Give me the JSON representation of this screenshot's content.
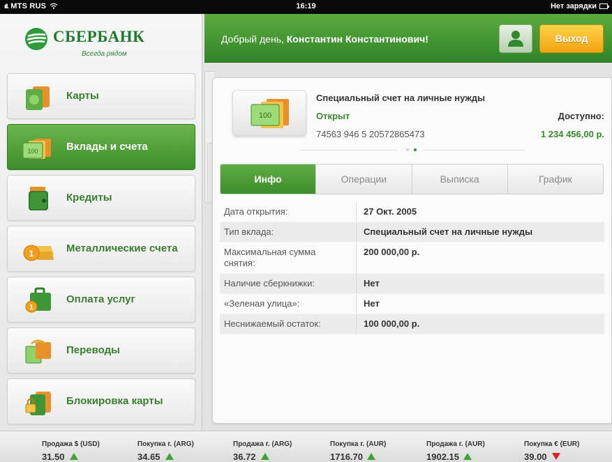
{
  "statusbar": {
    "carrier": "MTS RUS",
    "time": "16:19",
    "battery": "Нет зарядки"
  },
  "brand": {
    "name": "СБЕРБАНК",
    "tagline": "Всегда рядом"
  },
  "header": {
    "greeting_prefix": "Добрый день,",
    "user_name": "Константин Константинович!",
    "exit_label": "Выход"
  },
  "menu": [
    {
      "label": "Карты",
      "icon": "card-icon",
      "active": false
    },
    {
      "label": "Вклады и счета",
      "icon": "money-icon",
      "active": true
    },
    {
      "label": "Кредиты",
      "icon": "wallet-icon",
      "active": false
    },
    {
      "label": "Металлические счета",
      "icon": "gold-icon",
      "active": false
    },
    {
      "label": "Оплата услуг",
      "icon": "briefcase-icon",
      "active": false
    },
    {
      "label": "Переводы",
      "icon": "transfer-icon",
      "active": false
    },
    {
      "label": "Блокировка карты",
      "icon": "lock-icon",
      "active": false
    }
  ],
  "account": {
    "title": "Специальный счет на личные нужды",
    "status": "Открыт",
    "number": "74563 946 5 20572865473",
    "available_label": "Доступно:",
    "available_value": "1 234 456,00 р."
  },
  "tabs": [
    {
      "label": "Инфо",
      "active": true
    },
    {
      "label": "Операции",
      "active": false
    },
    {
      "label": "Выписка",
      "active": false
    },
    {
      "label": "График",
      "active": false
    }
  ],
  "info_rows": [
    {
      "key": "Дата открытия:",
      "value": "27 Окт. 2005"
    },
    {
      "key": "Тип вклада:",
      "value": "Специальный счет на личные нужды"
    },
    {
      "key": "Максимальная сумма снятия:",
      "value": "200 000,00 р."
    },
    {
      "key": "Наличие сберкнижки:",
      "value": "Нет"
    },
    {
      "key": "«Зеленая улица»:",
      "value": "Нет"
    },
    {
      "key": "Неснижаемый остаток:",
      "value": "100 000,00 р."
    }
  ],
  "ticker": [
    {
      "label": "Продажа $ (USD)",
      "value": "31.50",
      "trend": "up"
    },
    {
      "label": "Покупка г. (ARG)",
      "value": "34.65",
      "trend": "up"
    },
    {
      "label": "Продажа г. (ARG)",
      "value": "36.72",
      "trend": "up"
    },
    {
      "label": "Покупка г. (AUR)",
      "value": "1716.70",
      "trend": "up"
    },
    {
      "label": "Продажа г. (AUR)",
      "value": "1902.15",
      "trend": "up"
    },
    {
      "label": "Покупка € (EUR)",
      "value": "39.00",
      "trend": "down"
    }
  ],
  "colors": {
    "brand_green": "#3a8a2c",
    "accent_yellow": "#f3a412",
    "up": "#3fa234",
    "down": "#e02020"
  }
}
